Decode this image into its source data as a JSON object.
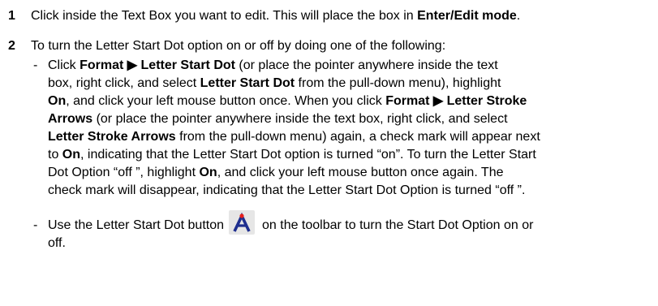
{
  "step1": {
    "number": "1",
    "text_a": "Click inside the Text Box you want to edit.  This will place the box in ",
    "bold_a": "Enter/Edit mode",
    "text_b": "."
  },
  "step2": {
    "number": "2",
    "intro": "To turn the Letter Start Dot option on or off by doing one of the following:",
    "bullet_dash": "-",
    "b1_l1_t1": "Click ",
    "b1_l1_b1": "Format ▶ Letter Start Dot",
    "b1_l1_t2": " (or place the pointer anywhere inside the text",
    "b1_l2_t1": "box, right click, and select ",
    "b1_l2_b1": "Letter Start Dot",
    "b1_l2_t2": " from the pull-down menu), highlight",
    "b1_l3_b1": "On",
    "b1_l3_t1": ", and click your left mouse button once. When you click ",
    "b1_l3_b2": "Format ▶ Letter Stroke",
    "b1_l4_b1": "Arrows",
    "b1_l4_t1": " (or place the pointer anywhere inside the text box, right click, and select",
    "b1_l5_b1": "Letter Stroke Arrows",
    "b1_l5_t1": " from the pull-down menu) again, a check mark will appear next",
    "b1_l6_t1": "to ",
    "b1_l6_b1": "On",
    "b1_l6_t2": ", indicating that the Letter Start Dot option is turned “on”.  To turn the Letter Start",
    "b1_l7_t1": "Dot Option “off ”, highlight ",
    "b1_l7_b1": "On",
    "b1_l7_t2": ", and click your left mouse button once again.  The",
    "b1_l8_t1": "check mark will disappear, indicating that the Letter Start Dot Option is turned “off ”.",
    "b2_l1_t1": "Use the Letter Start Dot button",
    "b2_l1_t2": "on the toolbar to turn the Start Dot Option on or",
    "b2_l2_t1": "off."
  },
  "colors": {
    "dot": "#e8201b",
    "glyph": "#1f2f8f",
    "button_bg": "#e6e6e6"
  },
  "icons": {
    "toolbar_button": "letter-start-dot-icon"
  }
}
